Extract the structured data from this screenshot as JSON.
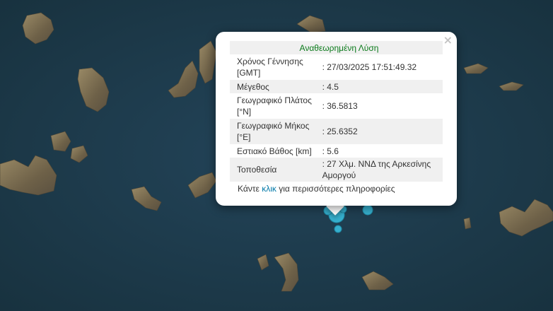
{
  "popup": {
    "title": "Αναθεωρημένη Λύση",
    "close_label": "×",
    "rows": [
      {
        "label": "Χρόνος Γέννησης [GMT]",
        "value": ": 27/03/2025 17:51:49.32"
      },
      {
        "label": "Μέγεθος",
        "value": ": 4.5"
      },
      {
        "label": "Γεωγραφικό Πλάτος [°N]",
        "value": ": 36.5813"
      },
      {
        "label": "Γεωγραφικό Μήκος [°E]",
        "value": ": 25.6352"
      },
      {
        "label": "Εστιακό Βάθος [km]",
        "value": ": 5.6"
      },
      {
        "label": "Τοποθεσία",
        "value": ": 27 Χλμ. ΝΝΔ της Αρκεσίνης Αμοργού"
      }
    ],
    "footer_before": "Κάντε ",
    "footer_link": "κλικ",
    "footer_after": " για περισσότερες πληροφορίες"
  },
  "colors": {
    "sea": "#1d3a4e",
    "land": "#7a6e54",
    "marker": "#38b6d4",
    "title": "#0a7a1a",
    "link": "#0078a8"
  }
}
